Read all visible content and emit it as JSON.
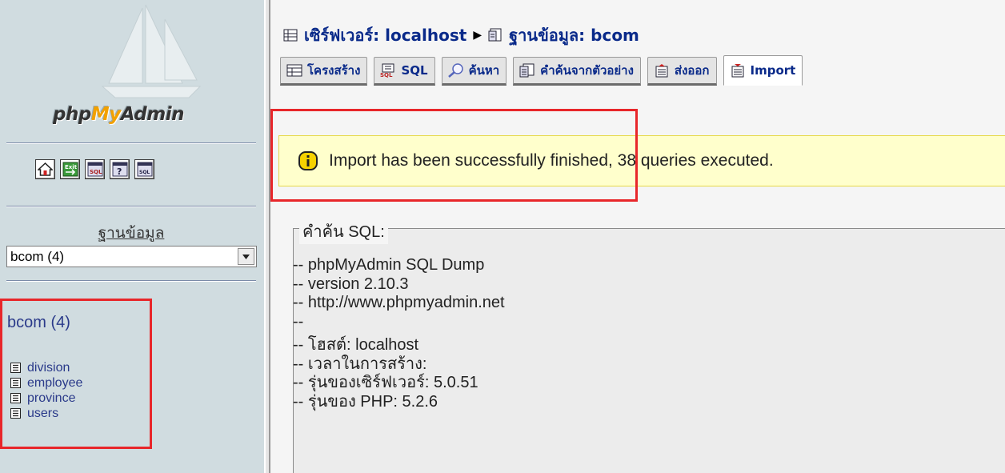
{
  "sidebar": {
    "logo": {
      "part1": "php",
      "part2": "My",
      "part3": "Admin"
    },
    "quick_icons": [
      "home-icon",
      "exit-icon",
      "sql-query-icon",
      "help-icon",
      "sql-docs-icon"
    ],
    "db_label": "ฐานข้อมูล",
    "db_select_value": "bcom (4)",
    "tree_db": "bcom (4)",
    "tables": [
      "division",
      "employee",
      "province",
      "users"
    ]
  },
  "breadcrumb": {
    "server": "เซิร์ฟเวอร์: localhost",
    "database": "ฐานข้อมูล: bcom"
  },
  "tabs": [
    {
      "label": "โครงสร้าง",
      "icon": "structure-icon"
    },
    {
      "label": "SQL",
      "icon": "sql-icon"
    },
    {
      "label": "ค้นหา",
      "icon": "search-icon"
    },
    {
      "label": "คำค้นจากตัวอย่าง",
      "icon": "query-icon"
    },
    {
      "label": "ส่งออก",
      "icon": "export-icon"
    },
    {
      "label": "Import",
      "icon": "import-icon"
    }
  ],
  "notice": {
    "text": "Import has been successfully finished, 38 queries executed."
  },
  "sql_panel": {
    "legend": "คำค้น SQL:",
    "lines": [
      "-- phpMyAdmin SQL Dump",
      "-- version 2.10.3",
      "-- http://www.phpmyadmin.net",
      "--",
      "-- โฮสต์: localhost",
      "-- เวลาในการสร้าง:",
      "-- รุ่นของเซิร์ฟเวอร์: 5.0.51",
      "-- รุ่นของ PHP: 5.2.6"
    ]
  },
  "colors": {
    "link": "#0a2a8a",
    "highlight": "#e8262a",
    "notice_bg": "#ffffcc"
  }
}
